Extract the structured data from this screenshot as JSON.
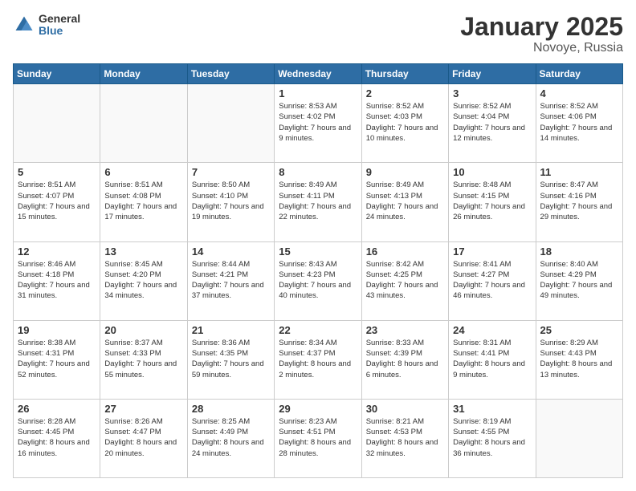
{
  "logo": {
    "general": "General",
    "blue": "Blue"
  },
  "header": {
    "title": "January 2025",
    "subtitle": "Novoye, Russia"
  },
  "weekdays": [
    "Sunday",
    "Monday",
    "Tuesday",
    "Wednesday",
    "Thursday",
    "Friday",
    "Saturday"
  ],
  "weeks": [
    [
      {
        "day": "",
        "info": ""
      },
      {
        "day": "",
        "info": ""
      },
      {
        "day": "",
        "info": ""
      },
      {
        "day": "1",
        "info": "Sunrise: 8:53 AM\nSunset: 4:02 PM\nDaylight: 7 hours and 9 minutes."
      },
      {
        "day": "2",
        "info": "Sunrise: 8:52 AM\nSunset: 4:03 PM\nDaylight: 7 hours and 10 minutes."
      },
      {
        "day": "3",
        "info": "Sunrise: 8:52 AM\nSunset: 4:04 PM\nDaylight: 7 hours and 12 minutes."
      },
      {
        "day": "4",
        "info": "Sunrise: 8:52 AM\nSunset: 4:06 PM\nDaylight: 7 hours and 14 minutes."
      }
    ],
    [
      {
        "day": "5",
        "info": "Sunrise: 8:51 AM\nSunset: 4:07 PM\nDaylight: 7 hours and 15 minutes."
      },
      {
        "day": "6",
        "info": "Sunrise: 8:51 AM\nSunset: 4:08 PM\nDaylight: 7 hours and 17 minutes."
      },
      {
        "day": "7",
        "info": "Sunrise: 8:50 AM\nSunset: 4:10 PM\nDaylight: 7 hours and 19 minutes."
      },
      {
        "day": "8",
        "info": "Sunrise: 8:49 AM\nSunset: 4:11 PM\nDaylight: 7 hours and 22 minutes."
      },
      {
        "day": "9",
        "info": "Sunrise: 8:49 AM\nSunset: 4:13 PM\nDaylight: 7 hours and 24 minutes."
      },
      {
        "day": "10",
        "info": "Sunrise: 8:48 AM\nSunset: 4:15 PM\nDaylight: 7 hours and 26 minutes."
      },
      {
        "day": "11",
        "info": "Sunrise: 8:47 AM\nSunset: 4:16 PM\nDaylight: 7 hours and 29 minutes."
      }
    ],
    [
      {
        "day": "12",
        "info": "Sunrise: 8:46 AM\nSunset: 4:18 PM\nDaylight: 7 hours and 31 minutes."
      },
      {
        "day": "13",
        "info": "Sunrise: 8:45 AM\nSunset: 4:20 PM\nDaylight: 7 hours and 34 minutes."
      },
      {
        "day": "14",
        "info": "Sunrise: 8:44 AM\nSunset: 4:21 PM\nDaylight: 7 hours and 37 minutes."
      },
      {
        "day": "15",
        "info": "Sunrise: 8:43 AM\nSunset: 4:23 PM\nDaylight: 7 hours and 40 minutes."
      },
      {
        "day": "16",
        "info": "Sunrise: 8:42 AM\nSunset: 4:25 PM\nDaylight: 7 hours and 43 minutes."
      },
      {
        "day": "17",
        "info": "Sunrise: 8:41 AM\nSunset: 4:27 PM\nDaylight: 7 hours and 46 minutes."
      },
      {
        "day": "18",
        "info": "Sunrise: 8:40 AM\nSunset: 4:29 PM\nDaylight: 7 hours and 49 minutes."
      }
    ],
    [
      {
        "day": "19",
        "info": "Sunrise: 8:38 AM\nSunset: 4:31 PM\nDaylight: 7 hours and 52 minutes."
      },
      {
        "day": "20",
        "info": "Sunrise: 8:37 AM\nSunset: 4:33 PM\nDaylight: 7 hours and 55 minutes."
      },
      {
        "day": "21",
        "info": "Sunrise: 8:36 AM\nSunset: 4:35 PM\nDaylight: 7 hours and 59 minutes."
      },
      {
        "day": "22",
        "info": "Sunrise: 8:34 AM\nSunset: 4:37 PM\nDaylight: 8 hours and 2 minutes."
      },
      {
        "day": "23",
        "info": "Sunrise: 8:33 AM\nSunset: 4:39 PM\nDaylight: 8 hours and 6 minutes."
      },
      {
        "day": "24",
        "info": "Sunrise: 8:31 AM\nSunset: 4:41 PM\nDaylight: 8 hours and 9 minutes."
      },
      {
        "day": "25",
        "info": "Sunrise: 8:29 AM\nSunset: 4:43 PM\nDaylight: 8 hours and 13 minutes."
      }
    ],
    [
      {
        "day": "26",
        "info": "Sunrise: 8:28 AM\nSunset: 4:45 PM\nDaylight: 8 hours and 16 minutes."
      },
      {
        "day": "27",
        "info": "Sunrise: 8:26 AM\nSunset: 4:47 PM\nDaylight: 8 hours and 20 minutes."
      },
      {
        "day": "28",
        "info": "Sunrise: 8:25 AM\nSunset: 4:49 PM\nDaylight: 8 hours and 24 minutes."
      },
      {
        "day": "29",
        "info": "Sunrise: 8:23 AM\nSunset: 4:51 PM\nDaylight: 8 hours and 28 minutes."
      },
      {
        "day": "30",
        "info": "Sunrise: 8:21 AM\nSunset: 4:53 PM\nDaylight: 8 hours and 32 minutes."
      },
      {
        "day": "31",
        "info": "Sunrise: 8:19 AM\nSunset: 4:55 PM\nDaylight: 8 hours and 36 minutes."
      },
      {
        "day": "",
        "info": ""
      }
    ]
  ]
}
